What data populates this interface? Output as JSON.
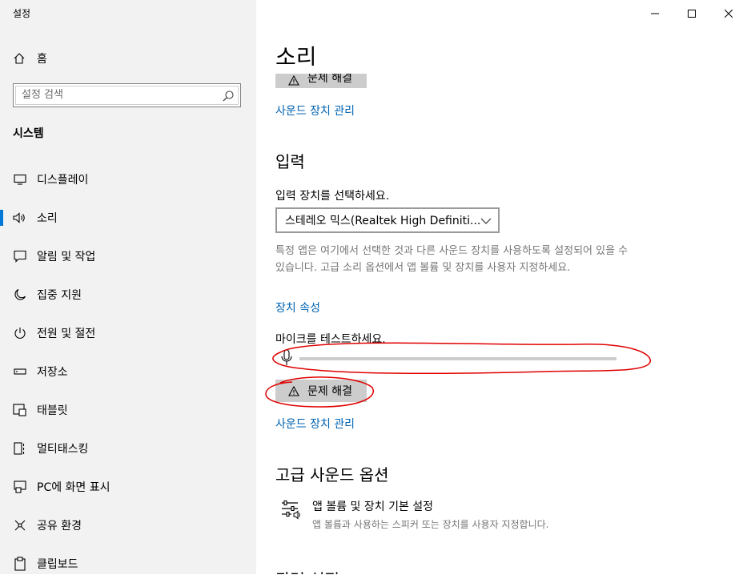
{
  "window": {
    "title": "설정"
  },
  "sidebar": {
    "home_label": "홈",
    "search_placeholder": "설정 검색",
    "section": "시스템",
    "items": [
      {
        "label": "디스플레이",
        "icon": "display-icon"
      },
      {
        "label": "소리",
        "icon": "speaker-icon",
        "active": true
      },
      {
        "label": "알림 및 작업",
        "icon": "notification-icon"
      },
      {
        "label": "집중 지원",
        "icon": "moon-icon"
      },
      {
        "label": "전원 및 절전",
        "icon": "power-icon"
      },
      {
        "label": "저장소",
        "icon": "storage-icon"
      },
      {
        "label": "태블릿",
        "icon": "tablet-icon"
      },
      {
        "label": "멀티태스킹",
        "icon": "multitask-icon"
      },
      {
        "label": "PC에 화면 표시",
        "icon": "project-icon"
      },
      {
        "label": "공유 환경",
        "icon": "share-icon"
      },
      {
        "label": "클립보드",
        "icon": "clipboard-icon"
      }
    ]
  },
  "main": {
    "title": "소리",
    "troubleshoot_label": "문제 해결",
    "manage_devices_link": "사운드 장치 관리",
    "input": {
      "heading": "입력",
      "choose_label": "입력 장치를 선택하세요.",
      "selected_device": "스테레오 믹스(Realtek High Definiti...",
      "description": "특정 앱은 여기에서 선택한 것과 다른 사운드 장치를 사용하도록 설정되어 있을 수 있습니다. 고급 소리 옵션에서 앱 볼륨 및 장치를 사용자 지정하세요.",
      "properties_link": "장치 속성",
      "test_label": "마이크를 테스트하세요.",
      "mic_level": 0
    },
    "advanced": {
      "heading": "고급 사운드 옵션",
      "app_volume_title": "앱 볼륨 및 장치 기본 설정",
      "app_volume_desc": "앱 볼륨과 사용하는 스피커 또는 장치를 사용자 지정합니다."
    },
    "next_heading": "관련 설정"
  },
  "colors": {
    "accent": "#0063b1",
    "annotation": "#e00000",
    "sidebar_bg": "#f2f2f2"
  }
}
